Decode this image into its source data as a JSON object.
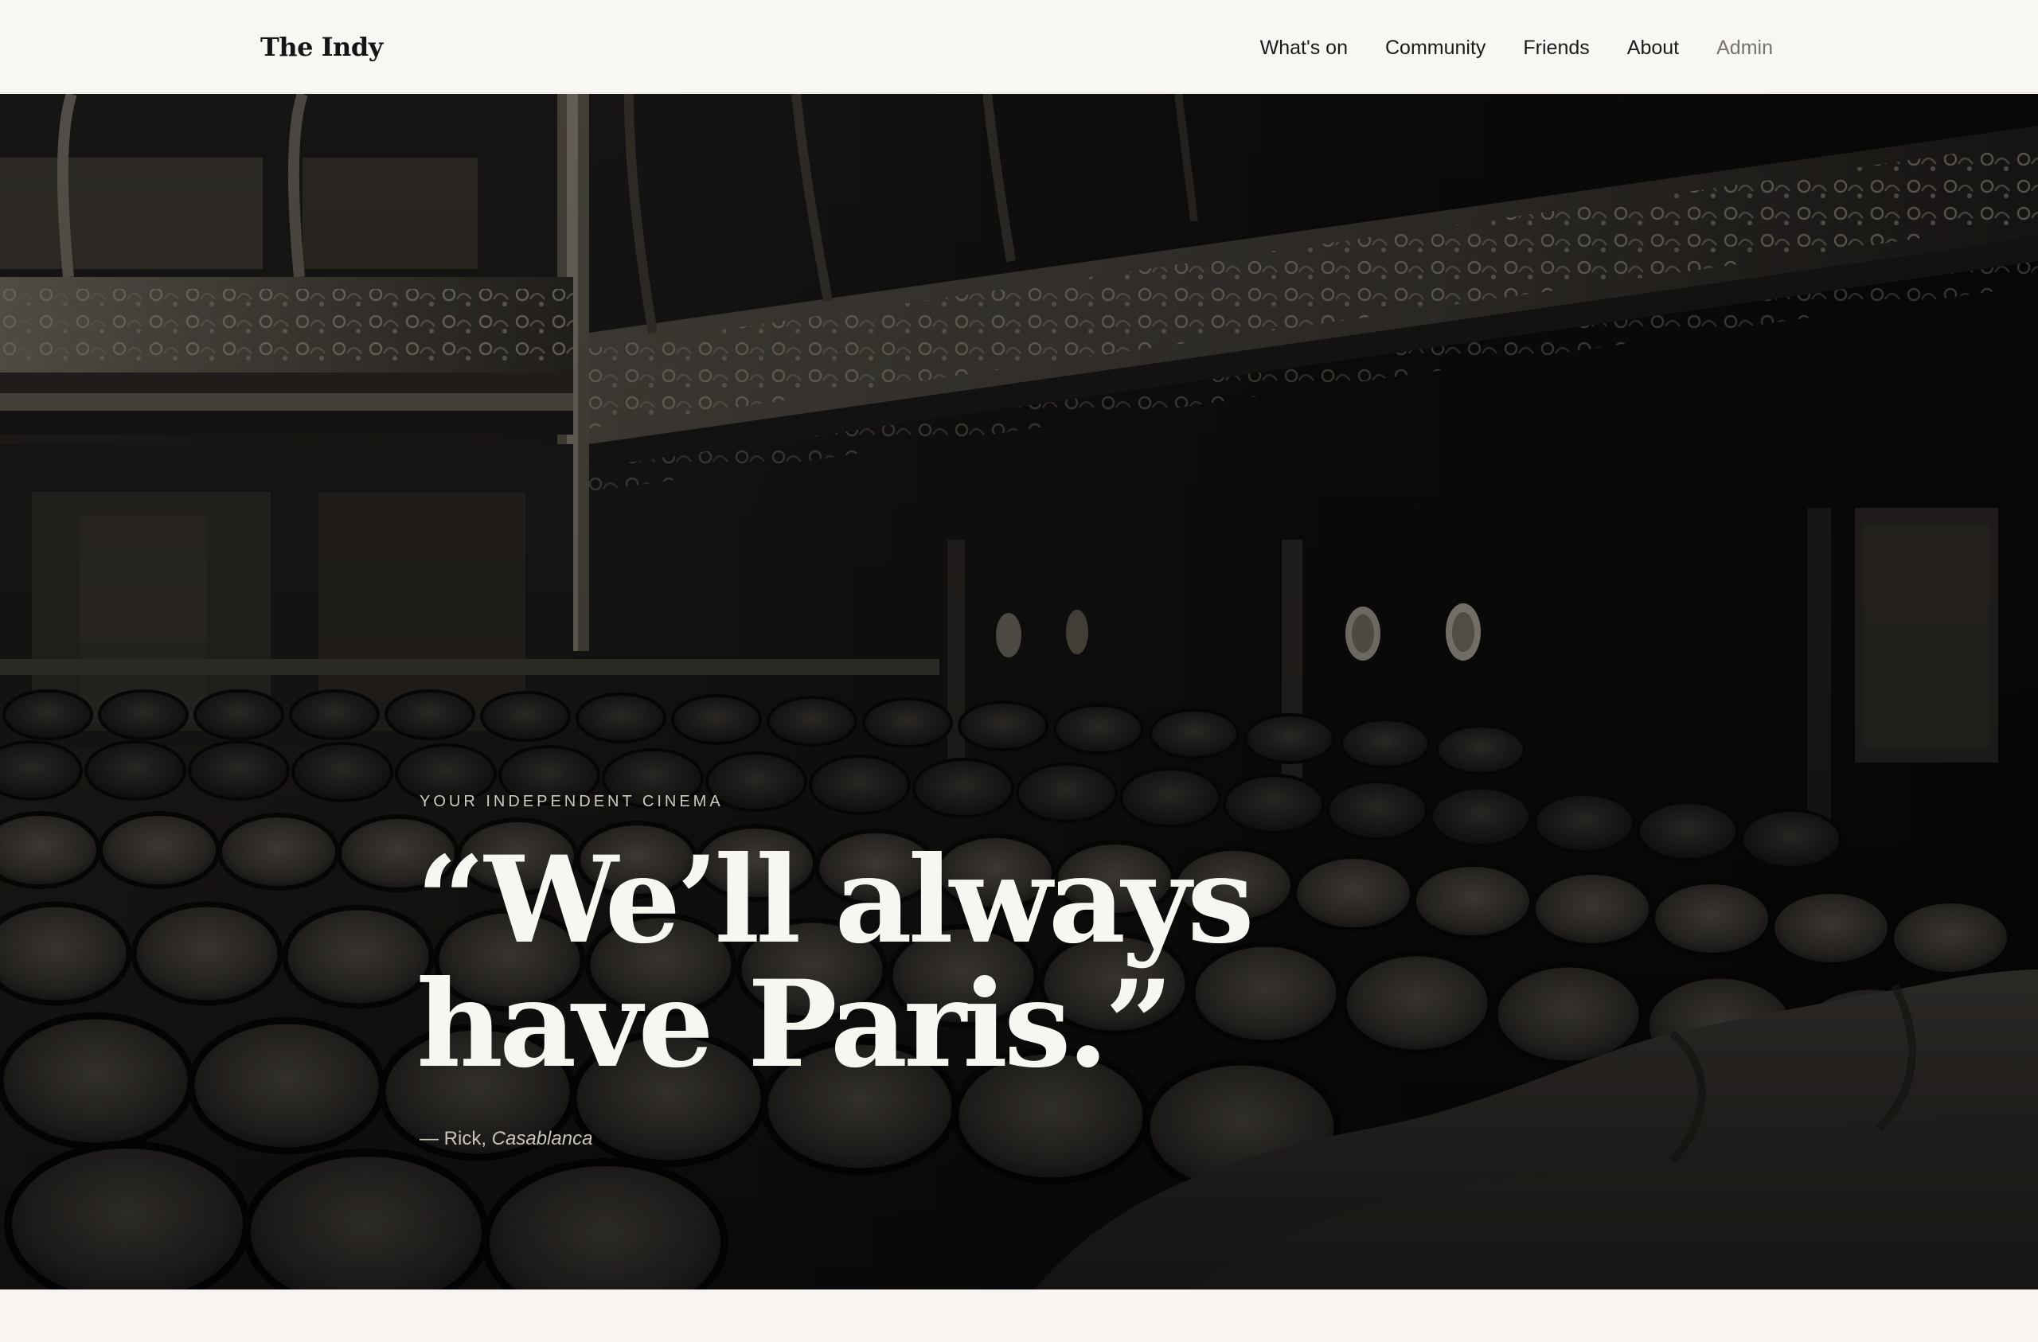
{
  "site": {
    "brand": "The Indy"
  },
  "nav": {
    "items": [
      {
        "label": "What's on"
      },
      {
        "label": "Community"
      },
      {
        "label": "Friends"
      },
      {
        "label": "About"
      },
      {
        "label": "Admin"
      }
    ]
  },
  "hero": {
    "eyebrow": "YOUR INDEPENDENT CINEMA",
    "quote": "“We’ll always have Paris.”",
    "attribution_prefix": "— Rick, ",
    "attribution_film": "Casablanca"
  },
  "colors": {
    "header_bg": "#f8f7f3",
    "page_bg": "#f8f5f0",
    "hero_bg": "#0c0b0a",
    "quote_text": "#f8f6f1",
    "nav_text": "#1b1b1b",
    "nav_muted": "#77736c"
  }
}
